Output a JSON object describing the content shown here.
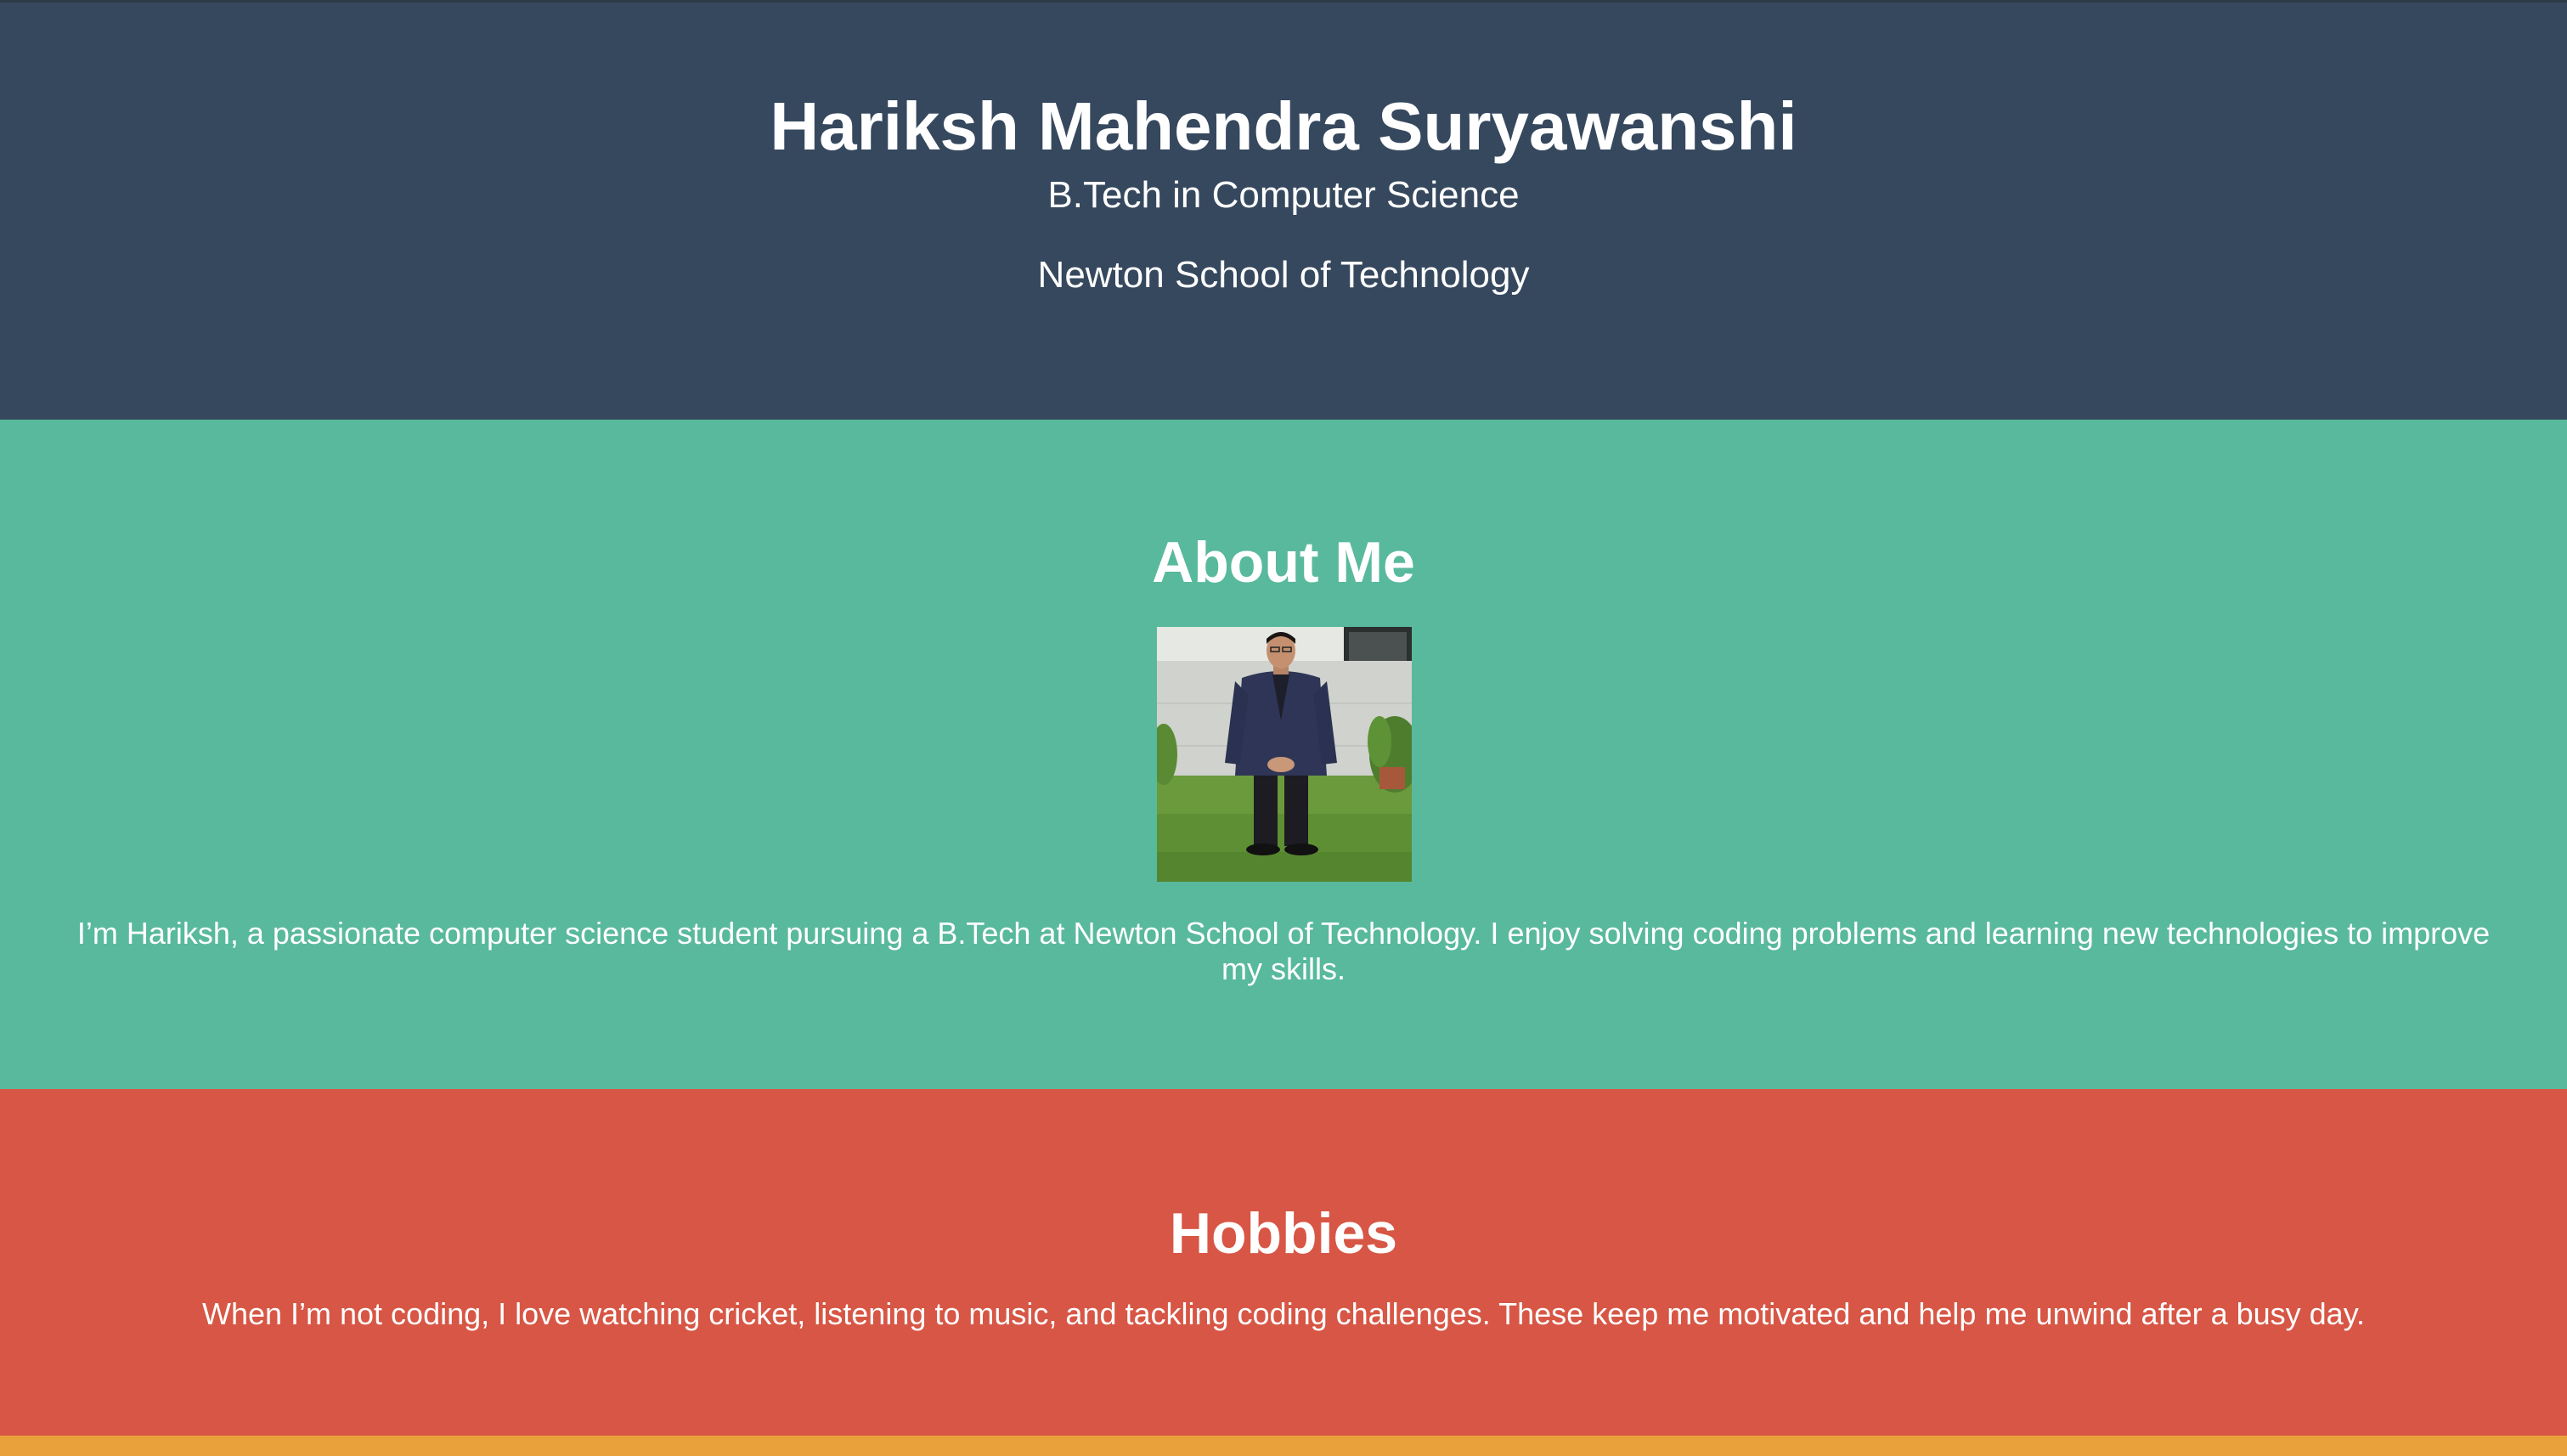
{
  "header": {
    "name": "Hariksh Mahendra Suryawanshi",
    "degree": "B.Tech in Computer Science",
    "school": "Newton School of Technology"
  },
  "about": {
    "title": "About Me",
    "photo_alt": "Profile photo of Hariksh",
    "text": "I’m Hariksh, a passionate computer science student pursuing a B.Tech at Newton School of Technology. I enjoy solving coding problems and learning new technologies to improve my skills."
  },
  "hobbies": {
    "title": "Hobbies",
    "text": "When I’m not coding, I love watching cricket, listening to music, and tackling coding challenges. These keep me motivated and help me unwind after a busy day."
  },
  "colors": {
    "header_bg": "#36485e",
    "about_bg": "#59b99c",
    "hobbies_bg": "#d75645",
    "footer_bg": "#e9a23b",
    "text": "#ffffff"
  }
}
